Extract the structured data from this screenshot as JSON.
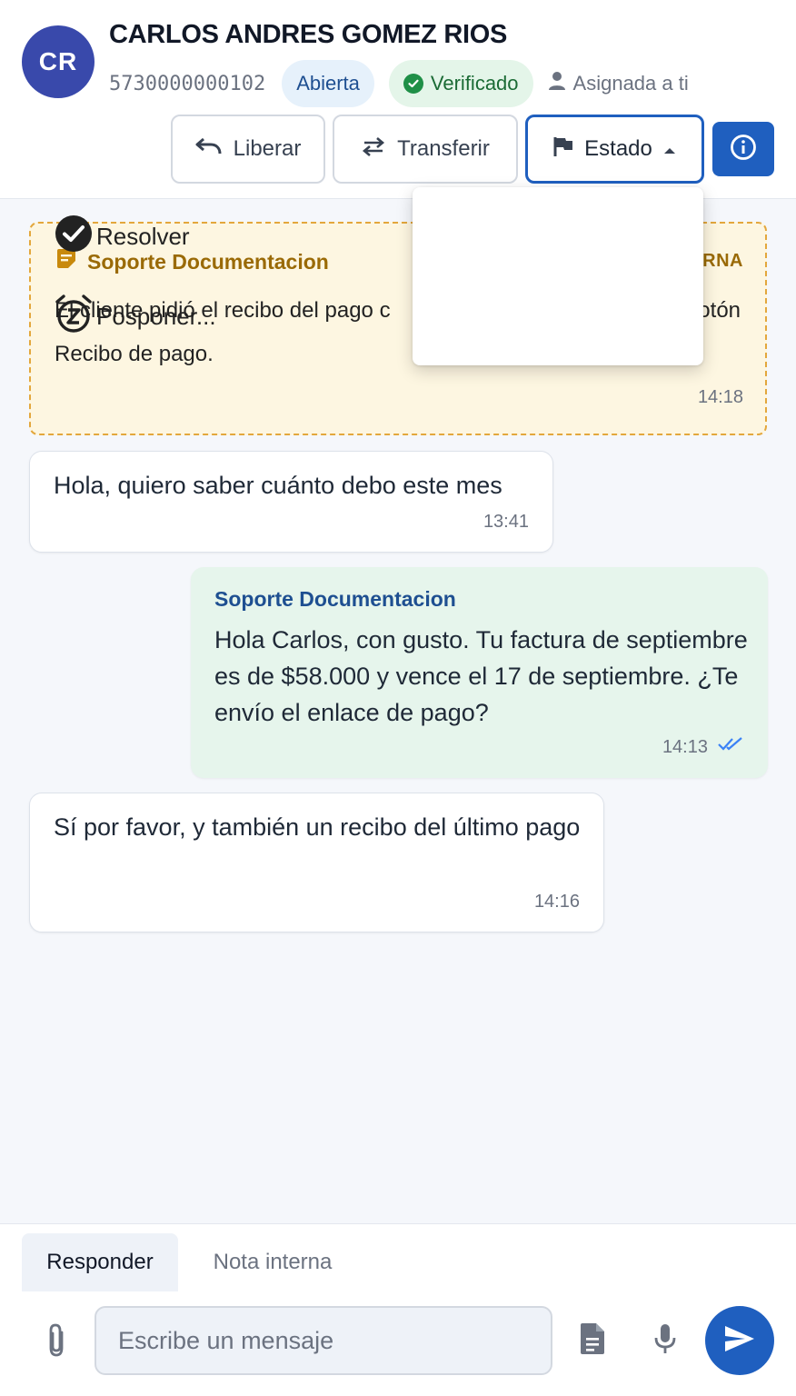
{
  "contact": {
    "initials": "CR",
    "name": "CARLOS ANDRES GOMEZ RIOS",
    "phone": "5730000000102",
    "status_badge": "Abierta",
    "verified_badge": "Verificado",
    "assigned": "Asignada a ti"
  },
  "toolbar": {
    "liberar_label": "Liberar",
    "transferir_label": "Transferir",
    "estado_label": "Estado",
    "info_icon": "info-icon"
  },
  "status_menu": {
    "items": [
      {
        "label": "Resolver",
        "icon": "check-circle-icon"
      },
      {
        "label": "Posponer...",
        "icon": "snooze-alarm-icon"
      }
    ]
  },
  "messages": {
    "internal_note": {
      "author": "Soporte Documentacion",
      "tag_visible": "RNA",
      "text": "El cliente pidió el recibo del pago c                                               l botón Recibo de pago.",
      "time": "14:18"
    },
    "incoming_1": {
      "text": "Hola, quiero saber cuánto debo este mes",
      "time": "13:41"
    },
    "outgoing_1": {
      "sender": "Soporte Documentacion",
      "text": "Hola Carlos, con gusto. Tu factura de septiembre es de $58.000 y vence el 17 de septiembre. ¿Te envío el enlace de pago?",
      "time": "14:13"
    },
    "incoming_2": {
      "text": "Sí por favor, y también un recibo del último pago",
      "time": "14:16"
    }
  },
  "composer": {
    "tab_reply": "Responder",
    "tab_note": "Nota interna",
    "placeholder": "Escribe un mensaje"
  },
  "colors": {
    "primary": "#1f5fbf",
    "avatar": "#3949ab",
    "note_bg": "#fdf6e1",
    "note_border": "#e3a73c",
    "outgoing_bg": "#e6f5ec",
    "verified": "#1f8f47"
  }
}
